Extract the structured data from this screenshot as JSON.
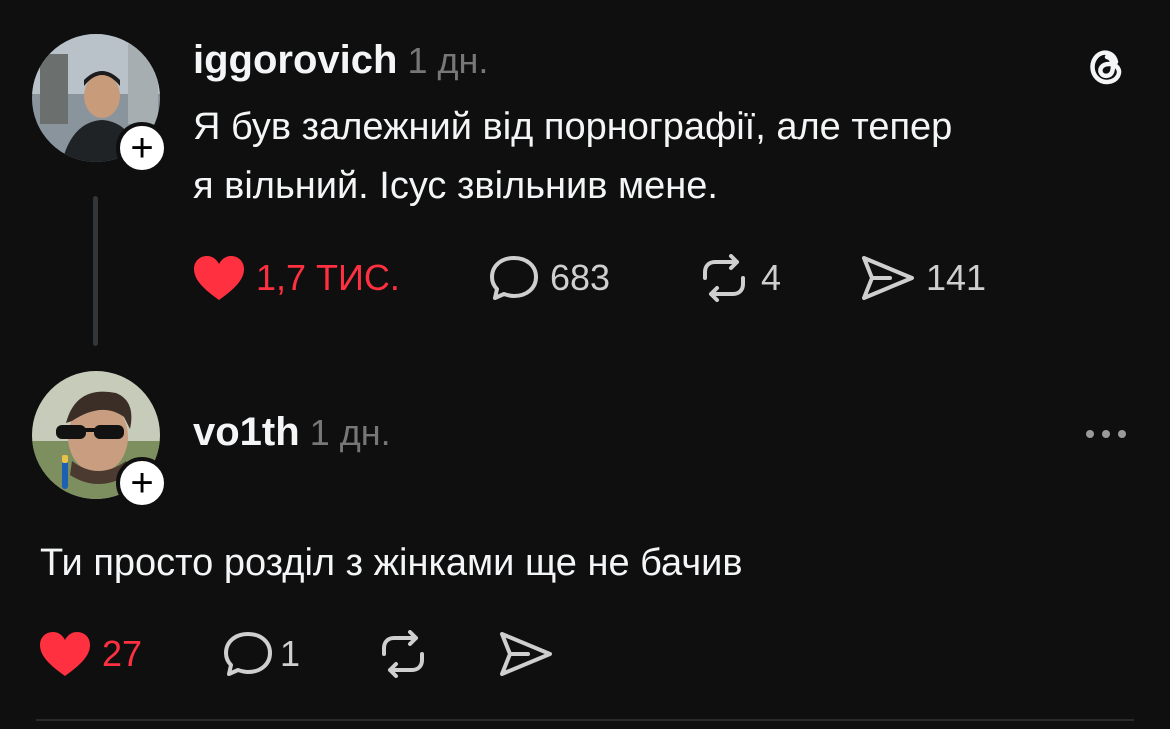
{
  "post": {
    "username": "iggorovich",
    "time": "1 дн.",
    "text_line1": "Я був залежний від порнографії, але тепер",
    "text_line2": "я вільний. Ісус звільнив мене.",
    "likes": "1,7 тис.",
    "comments": "683",
    "reposts": "4",
    "shares": "141",
    "like_color": "#ff3040"
  },
  "reply": {
    "username": "vo1th",
    "time": "1 дн.",
    "text": "Ти просто розділ з жінками ще не бачив",
    "likes": "27",
    "comments": "1"
  },
  "icons": {
    "app": "threads-logo-icon",
    "like": "heart-icon",
    "comment": "comment-bubble-icon",
    "repost": "repost-icon",
    "share": "send-icon",
    "more": "more-horizontal-icon",
    "follow": "plus-icon"
  }
}
